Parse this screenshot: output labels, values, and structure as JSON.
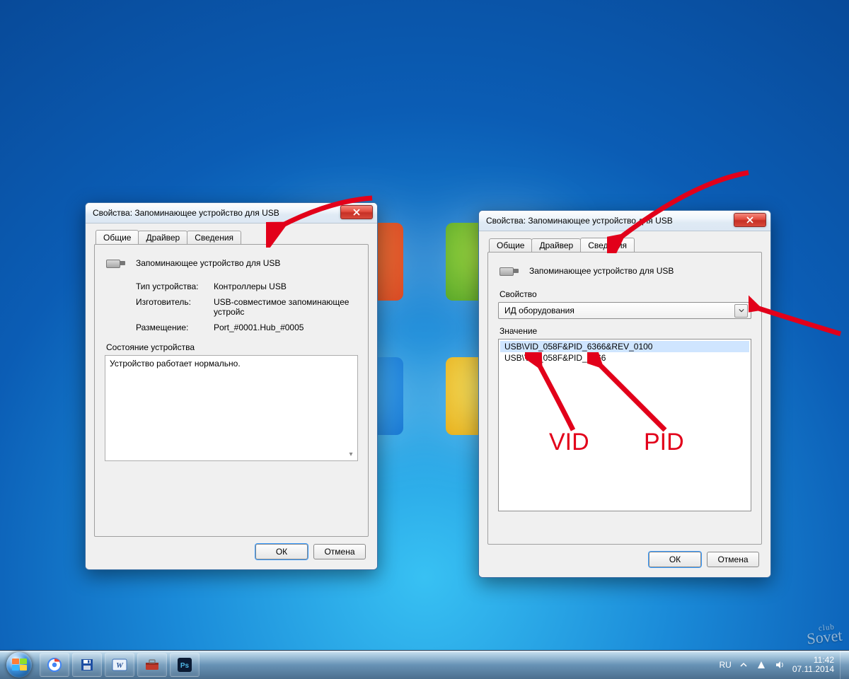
{
  "dialog_title": "Свойства: Запоминающее устройство для USB",
  "tabs": {
    "general": "Общие",
    "driver": "Драйвер",
    "details": "Сведения"
  },
  "device_name": "Запоминающее устройство для USB",
  "props": {
    "type_label": "Тип устройства:",
    "type_value": "Контроллеры USB",
    "mfr_label": "Изготовитель:",
    "mfr_value": "USB-совместимое запоминающее устройс",
    "loc_label": "Размещение:",
    "loc_value": "Port_#0001.Hub_#0005"
  },
  "status_label": "Состояние устройства",
  "status_text": "Устройство работает нормально.",
  "property_label": "Свойство",
  "property_value": "ИД оборудования",
  "value_label": "Значение",
  "hw_ids": [
    "USB\\VID_058F&PID_6366&REV_0100",
    "USB\\VID_058F&PID_6366"
  ],
  "btn_ok": "ОК",
  "btn_cancel": "Отмена",
  "annotations": {
    "vid": "VID",
    "pid": "PID"
  },
  "systray": {
    "lang": "RU",
    "time": "11:42",
    "date": "07.11.2014"
  },
  "watermark": {
    "small": "club",
    "big": "Sovet"
  }
}
